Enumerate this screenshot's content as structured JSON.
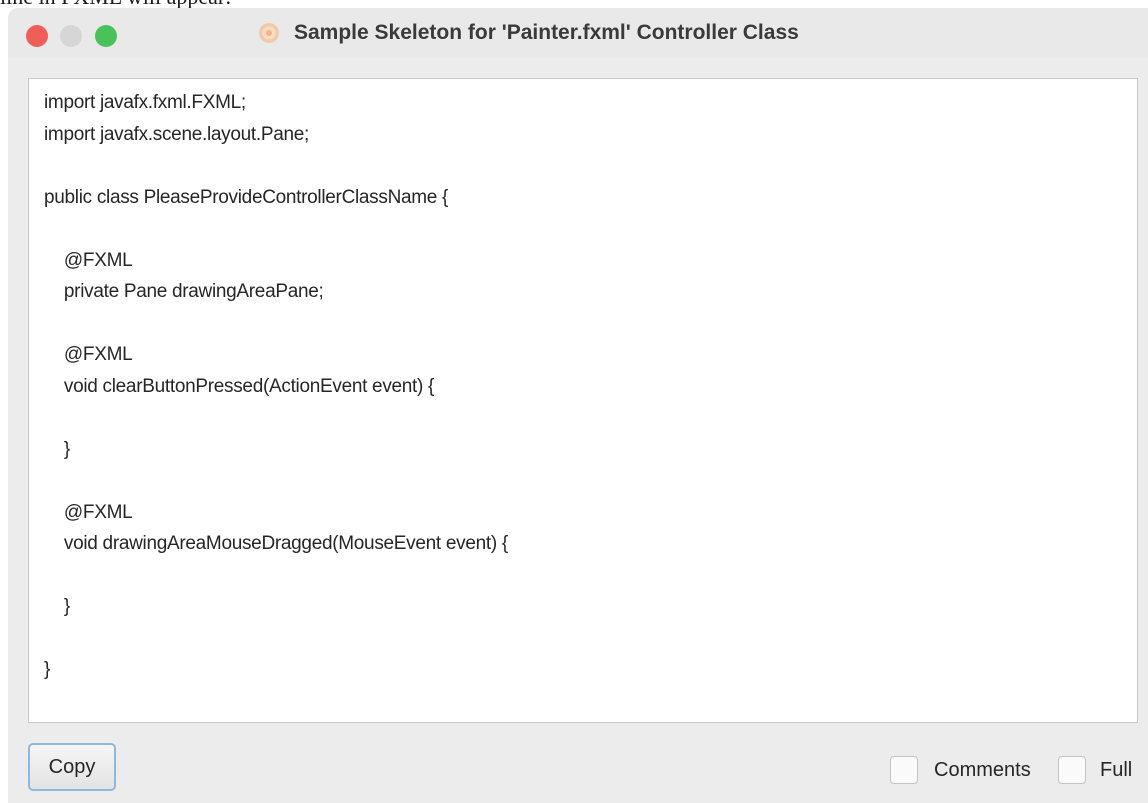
{
  "top_clip": "line in FXML will appear:",
  "window": {
    "title": "Sample Skeleton for 'Painter.fxml' Controller Class",
    "app_icon": "scene-builder-icon",
    "colors": {
      "close": "#ee5f58",
      "minimize": "#d6d6d6",
      "maximize": "#49c25a",
      "focus_ring": "#8fb8dd"
    }
  },
  "code_lines": [
    "import javafx.fxml.FXML;",
    "import javafx.scene.layout.Pane;",
    "",
    "public class PleaseProvideControllerClassName {",
    "",
    "    @FXML",
    "    private Pane drawingAreaPane;",
    "",
    "    @FXML",
    "    void clearButtonPressed(ActionEvent event) {",
    "",
    "    }",
    "",
    "    @FXML",
    "    void drawingAreaMouseDragged(MouseEvent event) {",
    "",
    "    }",
    "",
    "}"
  ],
  "footer": {
    "copy_label": "Copy",
    "comments_label": "Comments",
    "comments_checked": false,
    "full_label": "Full",
    "full_checked": false
  }
}
